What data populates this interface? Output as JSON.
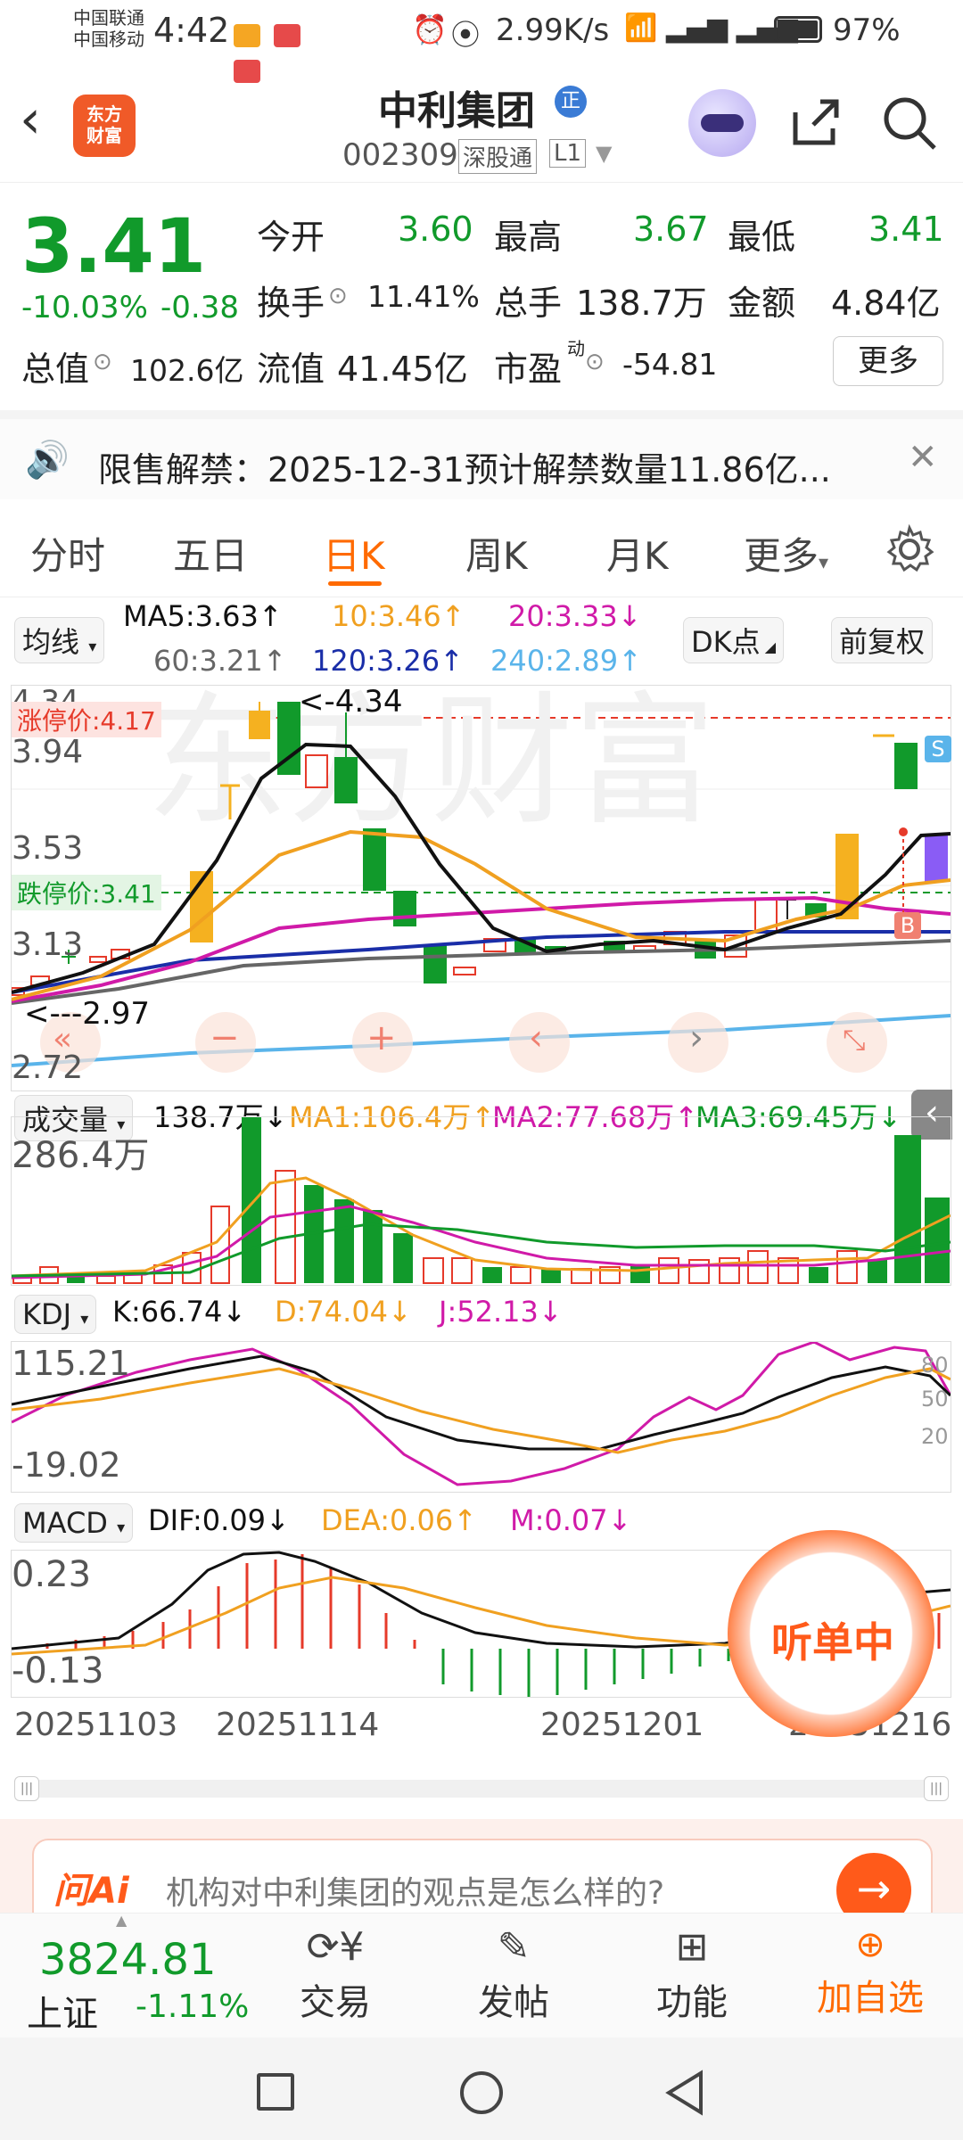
{
  "status": {
    "carrier1": "中国联通",
    "carrier2": "中国移动",
    "time": "4:42",
    "net_speed": "2.99K/s",
    "battery": "97%"
  },
  "header": {
    "title": "中利集团",
    "code": "002309",
    "exchange": "深股通",
    "level": "L1",
    "logo_text": "东方财富"
  },
  "quote": {
    "price": "3.41",
    "change_pct": "-10.03%",
    "change": "-0.38",
    "open_label": "今开",
    "open": "3.60",
    "high_label": "最高",
    "high": "3.67",
    "low_label": "最低",
    "low": "3.41",
    "turnover_label": "换手",
    "turnover": "11.41%",
    "volume_label": "总手",
    "volume": "138.7万",
    "amount_label": "金额",
    "amount": "4.84亿",
    "mktcap_label": "总值",
    "mktcap": "102.6亿",
    "float_label": "流值",
    "float": "41.45亿",
    "pe_label": "市盈",
    "pe_sup": "动",
    "pe": "-54.81",
    "more": "更多"
  },
  "ticker": {
    "text": "限售解禁：2025-12-31预计解禁数量11.86亿..."
  },
  "tabs": [
    "分时",
    "五日",
    "日K",
    "周K",
    "月K",
    "更多"
  ],
  "kline": {
    "ma_label": "均线",
    "ma5": "MA5:3.63↑",
    "ma10": "10:3.46↑",
    "ma20": "20:3.33↓",
    "ma60": "60:3.21↑",
    "ma120": "120:3.26↑",
    "ma240": "240:2.89↑",
    "dk_label": "DK点",
    "adjust_label": "前复权",
    "y_top": "4.34",
    "y_1": "3.94",
    "y_2": "3.53",
    "y_3": "3.13",
    "y_bottom": "2.72",
    "limit_up": "涨停价:4.17",
    "limit_down": "跌停价:3.41",
    "high_mark": "<-4.34",
    "low_mark": "<---2.97",
    "sell_badge": "S",
    "buy_badge": "B"
  },
  "volume": {
    "label": "成交量",
    "value": "138.7万↓",
    "ma1": "MA1:106.4万↑",
    "ma2": "MA2:77.68万↑",
    "ma3": "MA3:69.45万↓",
    "y_top": "286.4万"
  },
  "kdj": {
    "label": "KDJ",
    "k": "K:66.74↓",
    "d": "D:74.04↓",
    "j": "J:52.13↓",
    "y_top": "115.21",
    "y_bottom": "-19.02",
    "lvl80": "80",
    "lvl50": "50",
    "lvl20": "20"
  },
  "macd": {
    "label": "MACD",
    "dif": "DIF:0.09↓",
    "dea": "DEA:0.06↑",
    "m": "M:0.07↓",
    "y_top": "0.23",
    "y_bottom": "-0.13"
  },
  "dates": [
    "20251103",
    "20251114",
    "20251201",
    "20251216"
  ],
  "listening": "听单中",
  "ai": {
    "brand": "问Ai",
    "placeholder": "机构对中利集团的观点是怎么样的?"
  },
  "bottom": {
    "index_value": "3824.81",
    "index_name": "上证",
    "index_change": "-1.11%",
    "trade": "交易",
    "post": "发帖",
    "features": "功能",
    "add_watch": "加自选"
  },
  "colors": {
    "up": "#e63a2a",
    "down": "#119a2b",
    "accent": "#ff6a00",
    "ma5": "#111111",
    "ma10": "#f0a020",
    "ma20": "#d01aa8",
    "ma60": "#666666",
    "ma120": "#1a2ea8",
    "ma240": "#5ab4ea"
  }
}
